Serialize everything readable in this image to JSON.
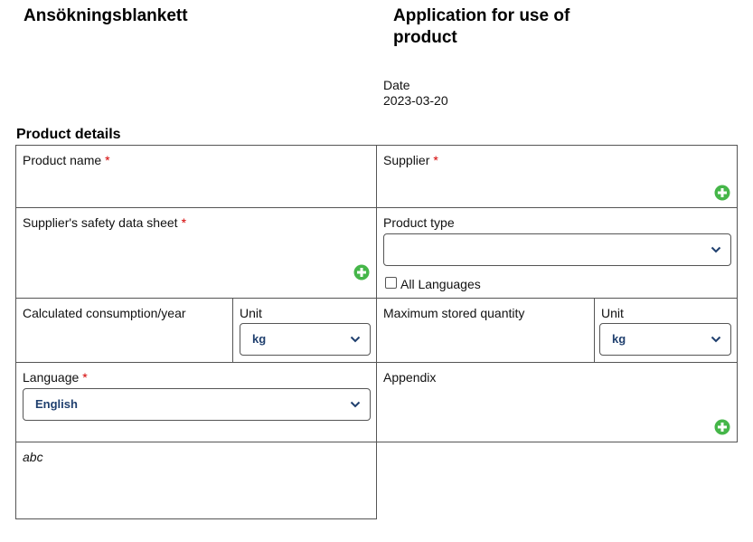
{
  "header": {
    "title_sv": "Ansökningsblankett",
    "title_en": "Application for use of product",
    "date_label": "Date",
    "date_value": "2023-03-20"
  },
  "section": {
    "title": "Product details"
  },
  "fields": {
    "product_name": {
      "label": "Product name",
      "required_mark": "*"
    },
    "supplier": {
      "label": "Supplier",
      "required_mark": "*"
    },
    "safety_data_sheet": {
      "label": "Supplier's safety data sheet",
      "required_mark": "*"
    },
    "product_type": {
      "label": "Product type",
      "value": ""
    },
    "all_languages": {
      "label": "All Languages",
      "checked": false
    },
    "calc_consumption": {
      "label": "Calculated consumption/year"
    },
    "unit_1": {
      "label": "Unit",
      "value": "kg"
    },
    "max_stored": {
      "label": "Maximum stored quantity"
    },
    "unit_2": {
      "label": "Unit",
      "value": "kg"
    },
    "language": {
      "label": "Language",
      "required_mark": "*",
      "value": "English"
    },
    "appendix": {
      "label": "Appendix"
    },
    "note": {
      "text": "abc"
    }
  },
  "icons": {
    "add": "plus-circle-icon",
    "dropdown": "chevron-down-icon"
  },
  "colors": {
    "required": "#d40000",
    "add_icon": "#45b649",
    "select_text": "#1f3f6e",
    "border": "#555555"
  }
}
